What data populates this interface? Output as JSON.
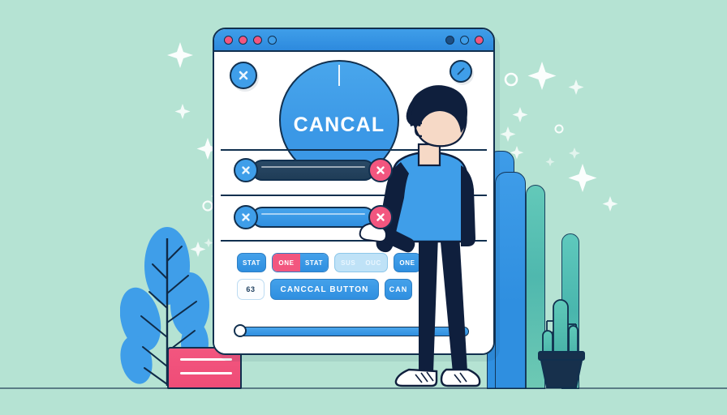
{
  "scene": {
    "title": "Cancel button UI illustration",
    "background_color": "#b5e3d3"
  },
  "palette": {
    "mint_background": "#b5e3d3",
    "primary_blue": "#3f9ee9",
    "deep_blue": "#2f8fe0",
    "navy_outline": "#11304f",
    "pink_accent": "#f2567f",
    "teal_bar": "#57c4b6",
    "white": "#ffffff",
    "pale_blue_chip": "#bfe2f7"
  },
  "window": {
    "titlebar": {
      "left_dots": [
        {
          "name": "dot-pink-1",
          "color": "#f2567f"
        },
        {
          "name": "dot-pink-2",
          "color": "#f2567f"
        },
        {
          "name": "dot-pink-3",
          "color": "#f2567f"
        },
        {
          "name": "dot-blue-4",
          "color": "#3f9ee9"
        }
      ],
      "right_dots": [
        {
          "name": "dot-dark-1",
          "color": "#1c4f85"
        },
        {
          "name": "dot-blue-2",
          "color": "#3f9ee9"
        },
        {
          "name": "dot-pink-3",
          "color": "#f2567f"
        }
      ]
    },
    "corner_buttons": {
      "top_left": {
        "icon": "close-x-icon",
        "label": "X"
      },
      "top_right": {
        "icon": "edit-pencil-icon",
        "label": "/"
      }
    },
    "dial": {
      "label": "CANCAL",
      "tick": "indicator-tick",
      "value_color": "#ffffff"
    },
    "sliders": [
      {
        "name": "slider-row-one",
        "left_knob": {
          "icon": "close-x-icon",
          "color": "#3f9ee9"
        },
        "track_color": "#2a4a66",
        "right_knob": {
          "icon": "close-x-icon",
          "color": "#f2567f"
        }
      },
      {
        "name": "slider-row-two",
        "left_knob": {
          "icon": "close-x-icon",
          "color": "#3f9ee9"
        },
        "track_color": "#3f9ee9",
        "right_knob": {
          "icon": "close-x-icon",
          "color": "#f2567f"
        }
      }
    ],
    "chip_row": [
      {
        "name": "chip-stat",
        "label": "STAT",
        "style": "blue"
      },
      {
        "name": "chip-one-stat",
        "labels": [
          "ONE",
          "STAT"
        ],
        "style": "split-pink-blue"
      },
      {
        "name": "chip-sus-ouc",
        "labels": [
          "SUS",
          "OUC"
        ],
        "style": "pale"
      },
      {
        "name": "chip-one",
        "label": "ONE",
        "style": "blue"
      }
    ],
    "button_row": {
      "badge": "63",
      "primary_label": "CANCCAL  BUTTON",
      "secondary_label": "CAN"
    },
    "bottom_slider": {
      "name": "bottom-progress-slider",
      "handle": "slider-handle",
      "fill_color": "#3f9ee9"
    }
  },
  "decor": {
    "plant": {
      "name": "leafy-plant",
      "leaf_color": "#3f9ee9"
    },
    "book": {
      "name": "pink-book",
      "color": "#f2567f"
    },
    "cactus": {
      "name": "potted-cactus",
      "body_color": "#57c4b6",
      "pot_color": "#17304c"
    },
    "blue_bars": [
      {
        "name": "blue-bar-tall"
      },
      {
        "name": "blue-bar-short"
      }
    ],
    "teal_bars": [
      {
        "name": "teal-bar-tall"
      },
      {
        "name": "teal-bar-short"
      }
    ],
    "person": {
      "name": "standing-person",
      "hair_color": "#0f1f3d",
      "shirt_color": "#3f9ee9",
      "shoes": "white-sneakers"
    }
  }
}
